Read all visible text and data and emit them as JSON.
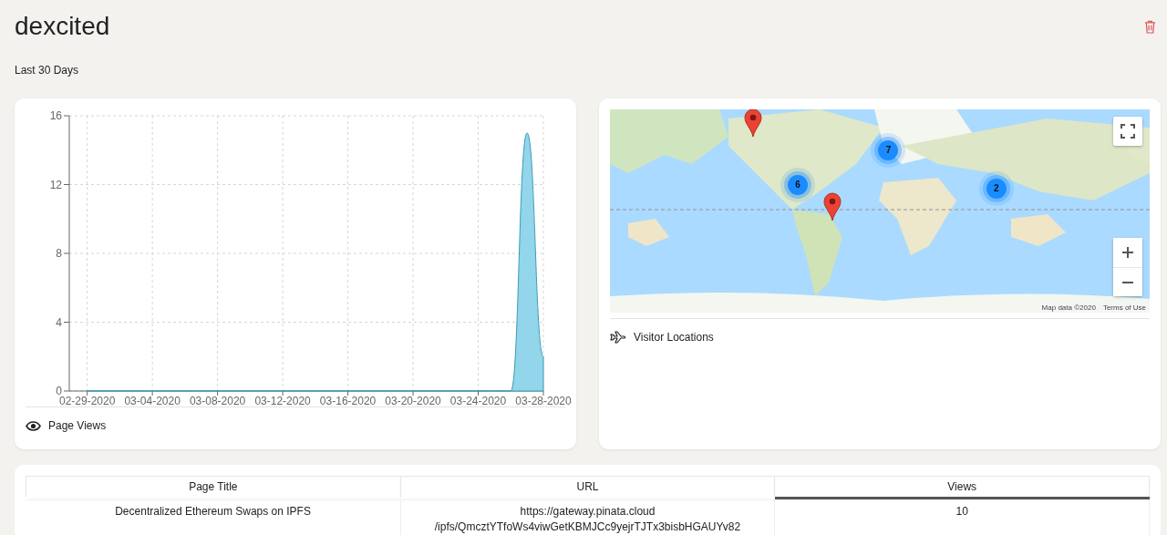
{
  "header": {
    "title": "dexcited",
    "period": "Last 30 Days"
  },
  "page_views": {
    "label": "Page Views",
    "chart_data": {
      "type": "area",
      "categories": [
        "02-29-2020",
        null,
        null,
        null,
        "03-04-2020",
        null,
        null,
        null,
        "03-08-2020",
        null,
        null,
        null,
        "03-12-2020",
        null,
        null,
        null,
        "03-16-2020",
        null,
        null,
        null,
        "03-20-2020",
        null,
        null,
        null,
        "03-24-2020",
        null,
        null,
        null,
        "03-28-2020"
      ],
      "series": [
        {
          "color": "#93d5ea",
          "values": [
            0,
            0,
            0,
            0,
            0,
            0,
            0,
            0,
            0,
            0,
            0,
            0,
            0,
            0,
            0,
            0,
            0,
            0,
            0,
            0,
            0,
            0,
            0,
            0,
            0,
            0,
            0,
            15,
            2
          ]
        }
      ],
      "ylim": [
        0,
        16
      ],
      "yticks": [
        0,
        4,
        8,
        12,
        16
      ],
      "grid": true
    }
  },
  "visitor_map": {
    "label": "Visitor Locations",
    "kind": "picture",
    "markers": [
      {
        "kind": "pin"
      },
      {
        "kind": "pin"
      },
      {
        "kind": "cluster",
        "count": "6"
      },
      {
        "kind": "cluster",
        "count": "7"
      },
      {
        "kind": "cluster",
        "count": "2"
      }
    ],
    "attribution": "Map data ©2020",
    "terms": "Terms of Use"
  },
  "table": {
    "columns": [
      {
        "label": "Page Title",
        "selected": false
      },
      {
        "label": "URL",
        "selected": false
      },
      {
        "label": "Views",
        "selected": true
      }
    ],
    "rows": [
      {
        "title": "Decentralized Ethereum Swaps on IPFS",
        "url_lines": [
          "https://gateway.pinata.cloud",
          "/ipfs/QmcztYTfoWs4viwGetKBMJCc9yejrTJTx3bisbHGAUYv82"
        ],
        "views": "10"
      }
    ]
  }
}
